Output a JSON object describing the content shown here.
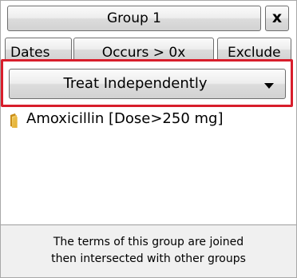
{
  "group": {
    "title": "Group 1",
    "close_label": "x"
  },
  "options": {
    "dates_label": "Dates",
    "occurs_label": "Occurs > 0x",
    "exclude_label": "Exclude"
  },
  "mode": {
    "selected": "Treat Independently"
  },
  "terms": [
    {
      "label": "Amoxicillin [Dose>250 mg]",
      "icon": "folder-icon"
    }
  ],
  "footer": {
    "line1": "The terms of this group are joined",
    "line2": "then intersected with other groups"
  },
  "colors": {
    "highlight": "#d81e2c",
    "folder": "#e8b93e"
  }
}
